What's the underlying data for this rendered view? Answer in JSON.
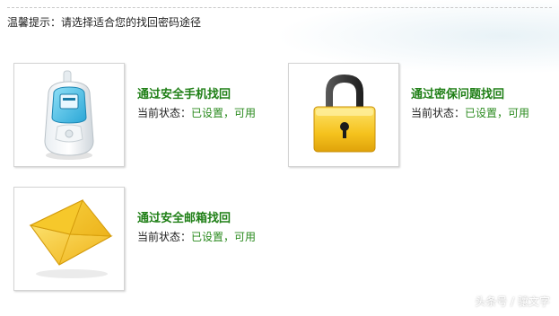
{
  "prompt": {
    "text": "温馨提示：请选择适合您的找回密码途径"
  },
  "options": [
    {
      "title": "通过安全手机找回",
      "status_label": "当前状态：",
      "status_value": "已设置，可用",
      "icon": "mobile-phone-icon"
    },
    {
      "title": "通过密保问题找回",
      "status_label": "当前状态：",
      "status_value": "已设置，可用",
      "icon": "padlock-icon"
    },
    {
      "title": "通过安全邮箱找回",
      "status_label": "当前状态：",
      "status_value": "已设置，可用",
      "icon": "envelope-icon"
    }
  ],
  "watermark": {
    "text": "头条号 / 骧文字"
  },
  "colors": {
    "title_green": "#1f7f16",
    "status_green": "#2a8a1e",
    "border": "#d4d4d4"
  }
}
